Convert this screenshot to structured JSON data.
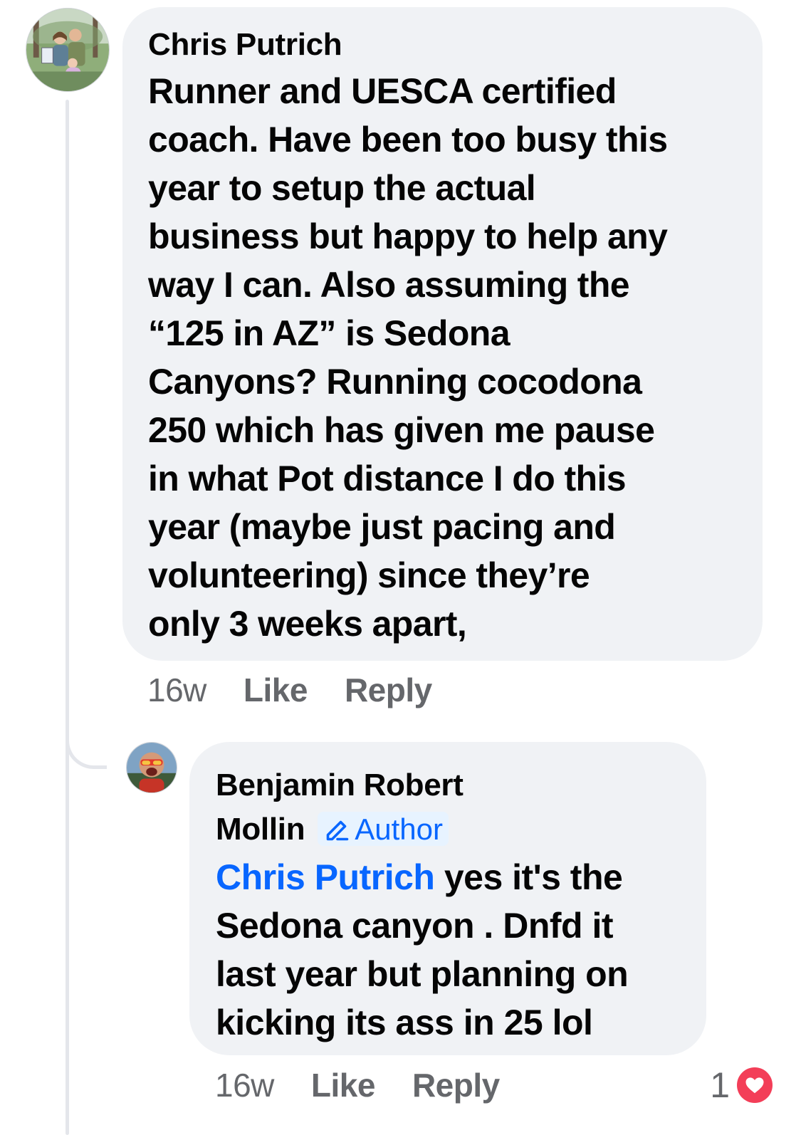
{
  "comment": {
    "author": "Chris Putrich",
    "lines": [
      "Runner and UESCA certified",
      "coach. Have been too busy this",
      "year to setup the actual",
      "business but happy to help any",
      "way I can. Also assuming the",
      "“125 in AZ” is Sedona",
      "Canyons? Running cocodona",
      "250 which has given me pause",
      "in what Pot distance I  do this",
      "year (maybe just pacing and",
      "volunteering) since they’re",
      "only 3 weeks apart,"
    ],
    "time": "16w",
    "like_label": "Like",
    "reply_label": "Reply"
  },
  "reply": {
    "author_line1": "Benjamin Robert",
    "author_line2": "Mollin",
    "badge_label": "Author",
    "mention": "Chris Putrich",
    "text_first": " yes it's the",
    "lines": [
      "Sedona canyon . Dnfd it",
      "last year but planning on",
      "kicking its ass in 25 lol"
    ],
    "time": "16w",
    "like_label": "Like",
    "reply_label": "Reply",
    "reaction_count": "1",
    "reaction_icon": "heart-icon"
  },
  "colors": {
    "bubble": "#f0f2f5",
    "link": "#0866ff",
    "muted": "#65676b",
    "heart": "#f33e58"
  }
}
